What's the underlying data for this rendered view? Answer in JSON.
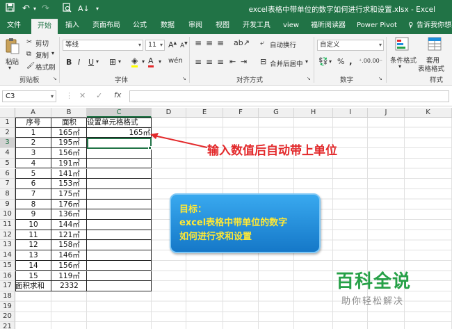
{
  "window": {
    "title": "excel表格中带单位的数字如何进行求和设置.xlsx - Excel",
    "quick_access": [
      "save-icon",
      "undo-icon",
      "redo-icon",
      "print-preview-icon",
      "sort-icon"
    ]
  },
  "ribbon_tabs": [
    "文件",
    "开始",
    "插入",
    "页面布局",
    "公式",
    "数据",
    "审阅",
    "视图",
    "开发工具",
    "view",
    "福昕阅读器",
    "Power Pivot",
    "告诉我你想要"
  ],
  "clipboard": {
    "paste": "粘贴",
    "cut": "剪切",
    "copy": "复制",
    "format_painter": "格式刷",
    "group": "剪贴板"
  },
  "font": {
    "name": "等线",
    "size": "11",
    "group": "字体"
  },
  "alignment": {
    "wrap": "自动换行",
    "merge": "合并后居中",
    "group": "对齐方式"
  },
  "number": {
    "format": "自定义",
    "percent": "%",
    "comma": ",",
    "group": "数字"
  },
  "styles": {
    "conditional": "条件格式",
    "table_format_1": "套用",
    "table_format_2": "表格格式",
    "group": "样式"
  },
  "formula_bar": {
    "name_box": "C3",
    "cancel": "✕",
    "confirm": "✓",
    "fx": "fx",
    "content": ""
  },
  "columns": [
    "A",
    "B",
    "C",
    "D",
    "E",
    "F",
    "G",
    "H",
    "I",
    "J",
    "K"
  ],
  "rows": [
    "1",
    "2",
    "3",
    "4",
    "5",
    "6",
    "7",
    "8",
    "9",
    "10",
    "11",
    "12",
    "13",
    "14",
    "15",
    "16",
    "17",
    "18",
    "19",
    "20",
    "21"
  ],
  "sheet": {
    "headers": [
      "序号",
      "面积",
      "设置单元格格式"
    ],
    "data": [
      [
        "1",
        "165㎡",
        "165㎡"
      ],
      [
        "2",
        "195㎡",
        ""
      ],
      [
        "3",
        "156㎡",
        ""
      ],
      [
        "4",
        "191㎡",
        ""
      ],
      [
        "5",
        "141㎡",
        ""
      ],
      [
        "6",
        "153㎡",
        ""
      ],
      [
        "7",
        "175㎡",
        ""
      ],
      [
        "8",
        "176㎡",
        ""
      ],
      [
        "9",
        "136㎡",
        ""
      ],
      [
        "10",
        "144㎡",
        ""
      ],
      [
        "11",
        "121㎡",
        ""
      ],
      [
        "12",
        "158㎡",
        ""
      ],
      [
        "13",
        "146㎡",
        ""
      ],
      [
        "14",
        "156㎡",
        ""
      ],
      [
        "15",
        "119㎡",
        ""
      ]
    ],
    "total": [
      "面积求和",
      "2332",
      ""
    ]
  },
  "annotation": "输入数值后自动带上单位",
  "goal_box": {
    "line1": "目标：",
    "line2": "excel表格中带单位的数字",
    "line3": "如何进行求和设置"
  },
  "watermark": {
    "brand": "百科全说",
    "slogan": "助你轻松解决"
  },
  "colors": {
    "excel_green": "#217346",
    "annotation_red": "#e3292b",
    "goal_blue": "#1f8fdd",
    "goal_text": "#ffe835",
    "brand_green": "#26a047"
  }
}
